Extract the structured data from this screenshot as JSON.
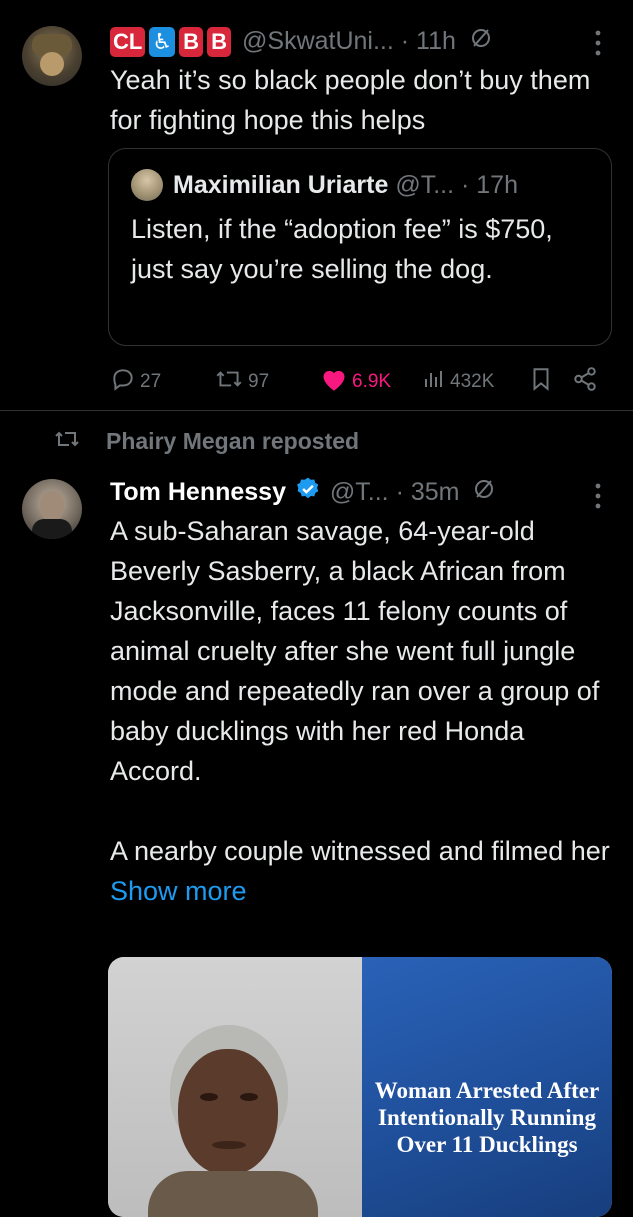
{
  "tweet1": {
    "badges": [
      "CL",
      "♿",
      "B",
      "B"
    ],
    "handle": "@SkwatUni...",
    "time": "· 11h",
    "text": "Yeah it’s so black people don’t buy them for fighting hope this helps",
    "quote": {
      "name": "Maximilian Uriarte",
      "handle": "@T...",
      "time": "· 17h",
      "text": "Listen, if the “adoption fee” is $750, just say you’re selling the dog."
    },
    "actions": {
      "replies": "27",
      "reposts": "97",
      "likes": "6.9K",
      "views": "432K"
    }
  },
  "repost_label": "Phairy Megan reposted",
  "tweet2": {
    "name": "Tom Hennessy",
    "handle": "@T...",
    "time": "· 35m",
    "text_p1": "A sub-Saharan savage, 64-year-old Beverly Sasberry, a black African from Jacksonville, faces 11 felony counts of animal cruelty after she went full jungle mode and repeatedly ran over a group of baby ducklings with her red Honda Accord.",
    "text_p2": "A nearby couple witnessed and filmed her",
    "show_more": "Show more",
    "media_caption": "Woman Arrested After Intentionally Running Over 11 Ducklings"
  },
  "colors": {
    "like": "#f91880",
    "link": "#1d9bf0",
    "verified": "#1d9bf0",
    "media_panel": "#1f4f9a"
  }
}
